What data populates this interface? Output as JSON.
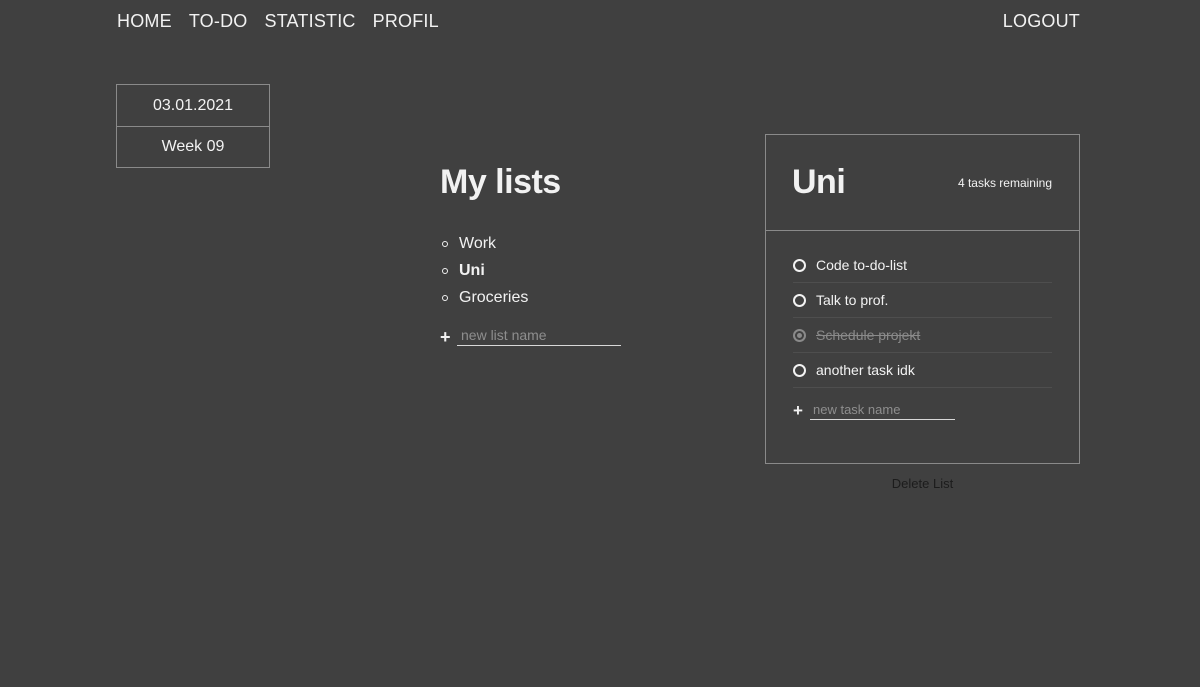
{
  "nav": {
    "items": [
      "HOME",
      "TO-DO",
      "STATISTIC",
      "PROFIL"
    ],
    "logout": "LOGOUT"
  },
  "date": {
    "value": "03.01.2021",
    "week": "Week 09"
  },
  "mylists": {
    "title": "My lists",
    "items": [
      {
        "label": "Work",
        "active": false
      },
      {
        "label": "Uni",
        "active": true
      },
      {
        "label": "Groceries",
        "active": false
      }
    ],
    "new_placeholder": "new list name"
  },
  "card": {
    "title": "Uni",
    "remaining": "4 tasks remaining",
    "tasks": [
      {
        "label": "Code to-do-list",
        "done": false
      },
      {
        "label": "Talk to prof.",
        "done": false
      },
      {
        "label": "Schedule projekt",
        "done": true
      },
      {
        "label": "another task idk",
        "done": false
      }
    ],
    "new_placeholder": "new task name",
    "delete_label": "Delete List"
  },
  "icons": {
    "add": "plus-icon",
    "task_check": "circle-check-icon",
    "list_bullet": "circle-bullet-icon"
  }
}
